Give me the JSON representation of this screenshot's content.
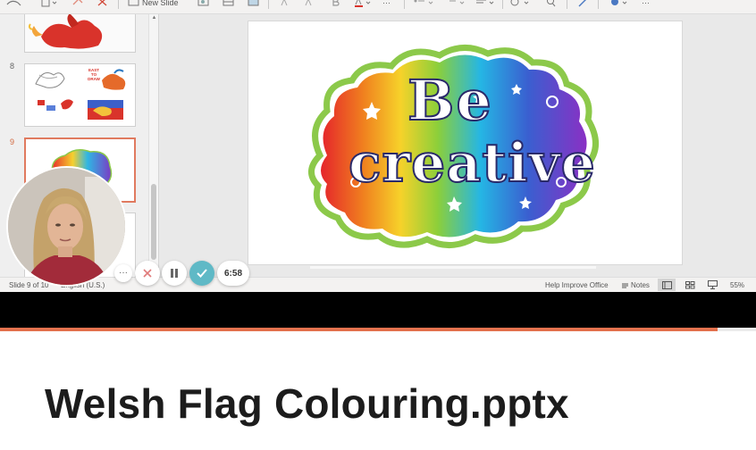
{
  "ribbon": {
    "new_slide_label": "New Slide",
    "more_label": "···"
  },
  "thumbnails": [
    {
      "number": "8",
      "texts": [
        "EAST",
        "TO",
        "DRAW"
      ]
    },
    {
      "number": "9"
    }
  ],
  "slide": {
    "headline_line1": "Be",
    "headline_line2": "creative"
  },
  "statusbar": {
    "slide_indicator": "Slide 9 of 10",
    "language": "English (U.S.)",
    "help_improve": "Help Improve Office",
    "notes_label": "Notes",
    "zoom": "55%"
  },
  "recorder": {
    "more_label": "···",
    "timer": "6:58",
    "progress_fraction": 0.949
  },
  "document": {
    "title": "Welsh Flag Colouring.pptx"
  },
  "colors": {
    "accent_orange": "#e3714d",
    "check_teal": "#5fb9c6",
    "dragon_red": "#d9332b"
  }
}
